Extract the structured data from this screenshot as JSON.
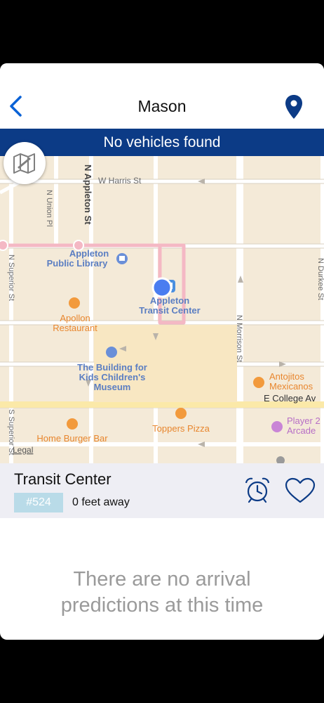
{
  "nav": {
    "title": "Mason"
  },
  "banner": {
    "text": "No vehicles found"
  },
  "map": {
    "streets": {
      "harris": "W Harris St",
      "appleton": "N Appleton St",
      "union": "N Union Pl",
      "superior1": "N Superior St",
      "superior2": "S Superior St",
      "morrison": "N Morrison St",
      "durkee": "N Durkee St",
      "college": "E College Av"
    },
    "places": {
      "library": [
        "Appleton",
        "Public Library"
      ],
      "transit": [
        "Appleton",
        "Transit Center"
      ],
      "apollon": [
        "Apollon",
        "Restaurant"
      ],
      "museum": [
        "The Building for",
        "Kids Children's",
        "Museum"
      ],
      "antojitos": [
        "Antojitos",
        "Mexicanos"
      ],
      "toppers": "Toppers Pizza",
      "homeburger": "Home Burger Bar",
      "player2": [
        "Player 2",
        "Arcade"
      ],
      "legal": "Legal"
    }
  },
  "stop": {
    "name": "Transit Center",
    "route": "#524",
    "distance": "0 feet away"
  },
  "empty_message": [
    "There are no arrival",
    "predictions at this time"
  ],
  "colors": {
    "accent": "#0a62d6",
    "banner": "#0c3b86",
    "route_line": "#f4b8c4",
    "user_dot": "#4a7df0"
  }
}
